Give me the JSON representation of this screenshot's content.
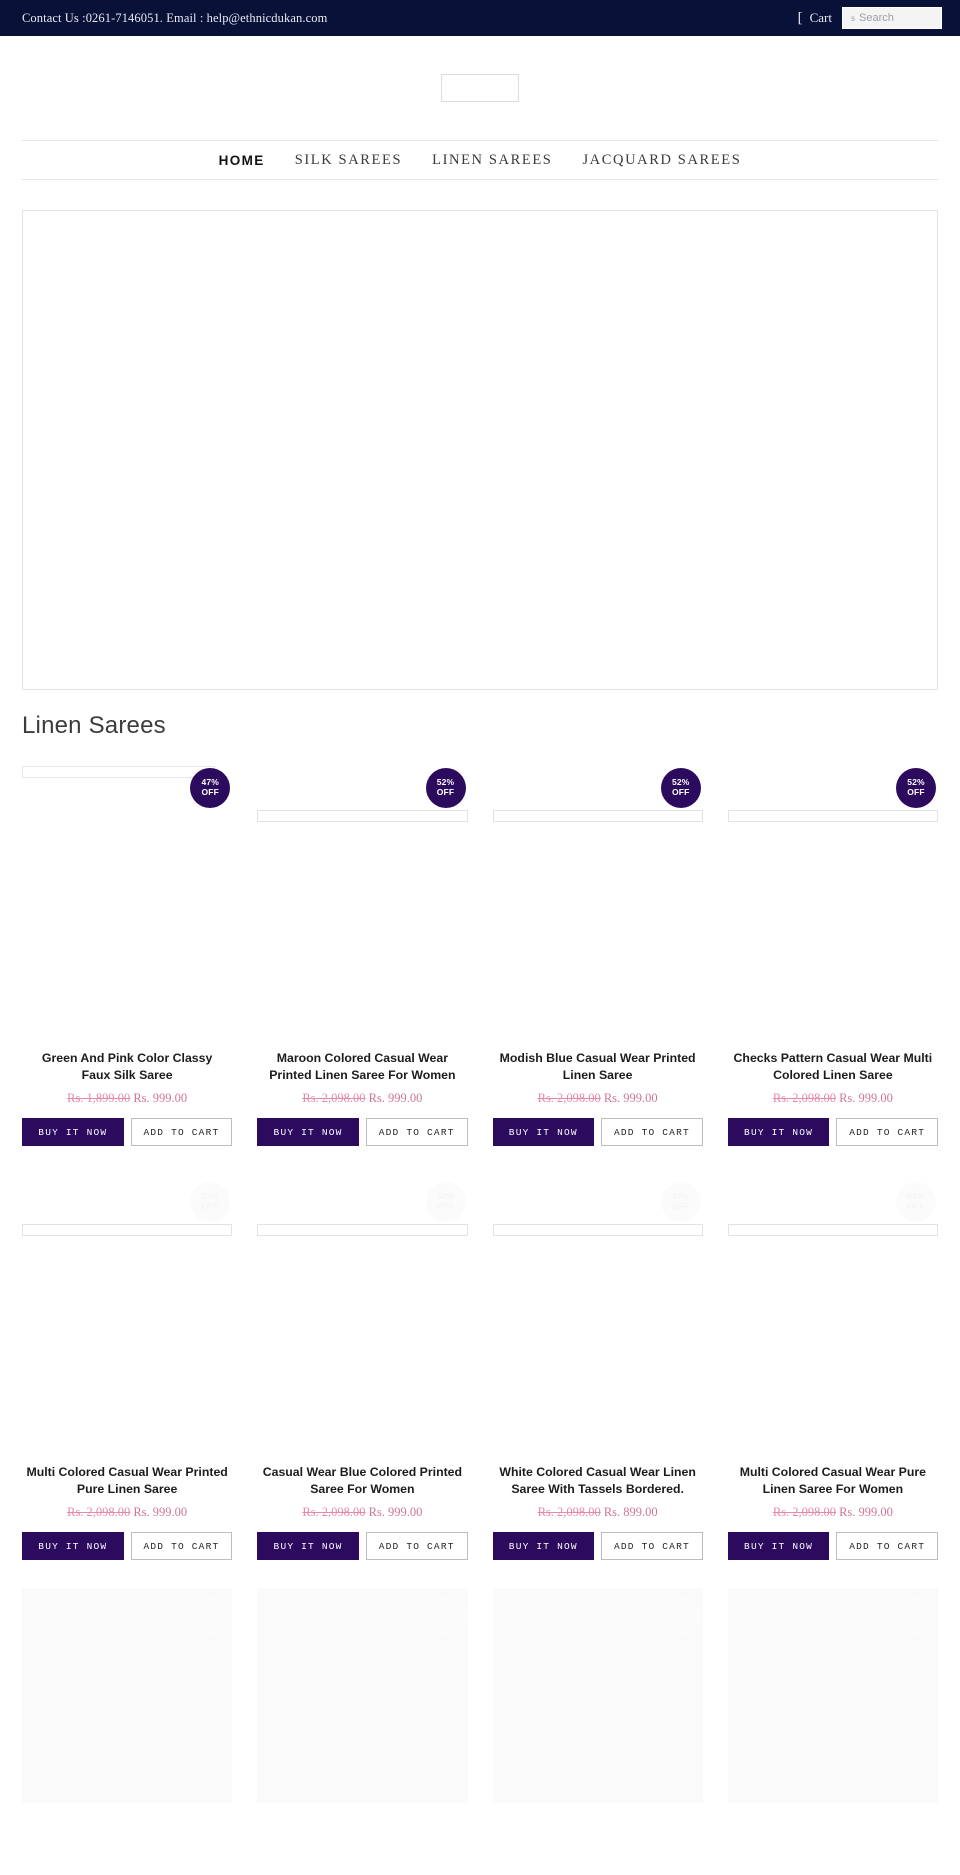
{
  "topbar": {
    "contact": "Contact Us :0261-7146051. Email : help@ethnicdukan.com",
    "cart_label": "Cart",
    "cart_icon": "cart-icon",
    "search_placeholder": "Search",
    "search_value": "",
    "search_broken_glyph": "s"
  },
  "logo": {
    "alt": "ethnic-dukan-logo"
  },
  "nav": {
    "items": [
      {
        "label": "HOME",
        "active": true
      },
      {
        "label": "SILK SAREES",
        "active": false
      },
      {
        "label": "LINEN SAREES",
        "active": false
      },
      {
        "label": "JACQUARD SAREES",
        "active": false
      }
    ]
  },
  "hero": {
    "alt": "hero-slider-banner"
  },
  "collection": {
    "title": "Linen Sarees",
    "buy_label": "BUY IT NOW",
    "cart_label": "ADD TO CART",
    "badge_suffix": "OFF",
    "accent_purple": "#2c0a5e",
    "price_pink": "#d07694",
    "products": [
      {
        "title": "Green And Pink Color Classy Faux Silk Saree",
        "price_old": "Rs. 1,899.00",
        "price_new": "Rs. 999.00",
        "discount": "47%",
        "badge_visible": true
      },
      {
        "title": "Maroon Colored Casual Wear Printed Linen Saree For Women",
        "price_old": "Rs. 2,098.00",
        "price_new": "Rs. 999.00",
        "discount": "52%",
        "badge_visible": true
      },
      {
        "title": "Modish Blue Casual Wear Printed Linen Saree",
        "price_old": "Rs. 2,098.00",
        "price_new": "Rs. 999.00",
        "discount": "52%",
        "badge_visible": true
      },
      {
        "title": "Checks Pattern Casual Wear Multi Colored Linen Saree",
        "price_old": "Rs. 2,098.00",
        "price_new": "Rs. 999.00",
        "discount": "52%",
        "badge_visible": true
      },
      {
        "title": "Multi Colored Casual Wear Printed Pure Linen Saree",
        "price_old": "Rs. 2,098.00",
        "price_new": "Rs. 999.00",
        "discount": "52%",
        "badge_visible": false
      },
      {
        "title": "Casual Wear Blue Colored Printed Saree For Women",
        "price_old": "Rs. 2,098.00",
        "price_new": "Rs. 999.00",
        "discount": "52%",
        "badge_visible": false
      },
      {
        "title": "White Colored Casual Wear Linen Saree With Tassels Bordered.",
        "price_old": "Rs. 2,098.00",
        "price_new": "Rs. 899.00",
        "discount": "57%",
        "badge_visible": false
      },
      {
        "title": "Multi Colored Casual Wear Pure Linen Saree For Women",
        "price_old": "Rs. 2,098.00",
        "price_new": "Rs. 999.00",
        "discount": "52%",
        "badge_visible": false
      }
    ]
  }
}
